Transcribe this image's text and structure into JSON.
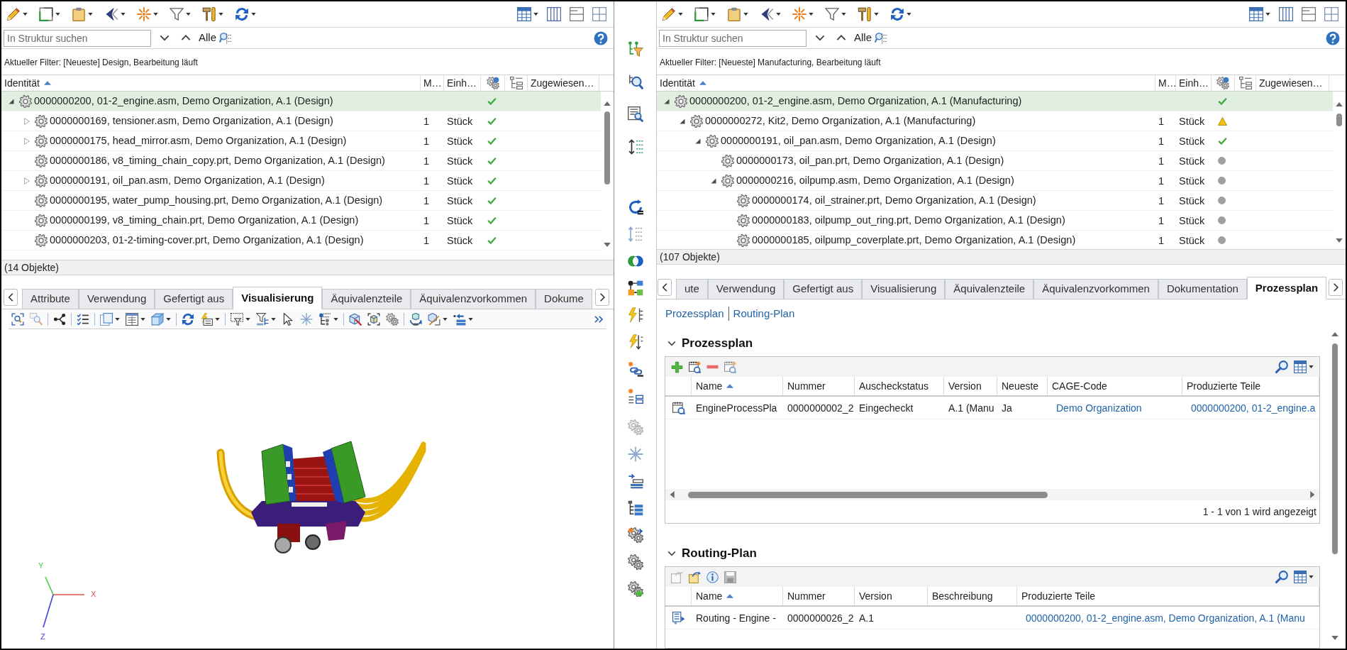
{
  "left_structure": {
    "search": {
      "placeholder": "In Struktur suchen",
      "scope": "Alle"
    },
    "filter": "Aktueller Filter: [Neueste] Design, Bearbeitung läuft",
    "columns": [
      {
        "kind": "text",
        "label": "Identität",
        "sorted": true
      },
      {
        "kind": "text",
        "label": "M…"
      },
      {
        "kind": "text",
        "label": "Einh…"
      },
      {
        "kind": "icon"
      },
      {
        "kind": "icon"
      },
      {
        "kind": "text",
        "label": "Zugewiesen…"
      }
    ],
    "rows": [
      {
        "identity": "0000000200, 01-2_engine.asm, Demo Organization, A.1 (Design)",
        "status": {
          "kind": "check"
        },
        "selected": true,
        "expanded": true,
        "children": [
          {
            "identity": "0000000169, tensioner.asm, Demo Organization, A.1 (Design)",
            "quantity": "1",
            "unit": "Stück",
            "status": {
              "kind": "check"
            },
            "selected": false,
            "expanded": false
          },
          {
            "identity": "0000000175, head_mirror.asm, Demo Organization, A.1 (Design)",
            "quantity": "1",
            "unit": "Stück",
            "status": {
              "kind": "check"
            },
            "selected": false,
            "expanded": false
          },
          {
            "identity": "0000000186, v8_timing_chain_copy.prt, Demo Organization, A.1 (Design)",
            "quantity": "1",
            "unit": "Stück",
            "status": {
              "kind": "check"
            },
            "selected": false
          },
          {
            "identity": "0000000191, oil_pan.asm, Demo Organization, A.1 (Design)",
            "quantity": "1",
            "unit": "Stück",
            "status": {
              "kind": "check"
            },
            "selected": false,
            "expanded": false
          },
          {
            "identity": "0000000195, water_pump_housing.prt, Demo Organization, A.1 (Design)",
            "quantity": "1",
            "unit": "Stück",
            "status": {
              "kind": "check"
            },
            "selected": false
          },
          {
            "identity": "0000000199, v8_timing_chain.prt, Demo Organization, A.1 (Design)",
            "quantity": "1",
            "unit": "Stück",
            "status": {
              "kind": "check"
            },
            "selected": false
          },
          {
            "identity": "0000000203, 01-2-timing-cover.prt, Demo Organization, A.1 (Design)",
            "quantity": "1",
            "unit": "Stück",
            "status": {
              "kind": "check"
            },
            "selected": false
          }
        ]
      }
    ],
    "count": "(14 Objekte)"
  },
  "left_details": {
    "tabs": [
      {
        "label": "Attribute",
        "selected": false
      },
      {
        "label": "Verwendung",
        "selected": false
      },
      {
        "label": "Gefertigt aus",
        "selected": false
      },
      {
        "label": "Visualisierung",
        "selected": true
      },
      {
        "label": "Äquivalenzteile",
        "selected": false
      },
      {
        "label": "Äquivalenzvorkommen",
        "selected": false
      },
      {
        "label": "Dokume",
        "selected": false
      }
    ],
    "viewer": {
      "axis_labels": {
        "y": "Y",
        "x": "X",
        "z": "Z"
      }
    }
  },
  "right_structure": {
    "search": {
      "placeholder": "In Struktur suchen",
      "scope": "Alle"
    },
    "filter": "Aktueller Filter: [Neueste] Manufacturing, Bearbeitung läuft",
    "columns": [
      {
        "kind": "text",
        "label": "Identität",
        "sorted": true
      },
      {
        "kind": "text",
        "label": "M…"
      },
      {
        "kind": "text",
        "label": "Einh…"
      },
      {
        "kind": "icon"
      },
      {
        "kind": "icon"
      },
      {
        "kind": "text",
        "label": "Zugewiesen…"
      }
    ],
    "rows": [
      {
        "identity": "0000000200, 01-2_engine.asm, Demo Organization, A.1 (Manufacturing)",
        "status": {
          "kind": "check"
        },
        "selected": true,
        "expanded": true,
        "children": [
          {
            "identity": "0000000272, Kit2, Demo Organization, A.1 (Manufacturing)",
            "quantity": "1",
            "unit": "Stück",
            "status": {
              "kind": "warning"
            },
            "selected": false,
            "expanded": true,
            "children": [
              {
                "identity": "0000000191, oil_pan.asm, Demo Organization, A.1 (Design)",
                "quantity": "1",
                "unit": "Stück",
                "status": {
                  "kind": "check"
                },
                "selected": false,
                "expanded": true,
                "children": [
                  {
                    "identity": "0000000173, oil_pan.prt, Demo Organization, A.1 (Design)",
                    "quantity": "1",
                    "unit": "Stück",
                    "status": {
                      "kind": "dot"
                    },
                    "selected": false
                  },
                  {
                    "identity": "0000000216, oilpump.asm, Demo Organization, A.1 (Design)",
                    "quantity": "1",
                    "unit": "Stück",
                    "status": {
                      "kind": "dot"
                    },
                    "selected": false,
                    "expanded": true,
                    "children": [
                      {
                        "identity": "0000000174, oil_strainer.prt, Demo Organization, A.1 (Design)",
                        "quantity": "1",
                        "unit": "Stück",
                        "status": {
                          "kind": "dot"
                        },
                        "selected": false
                      },
                      {
                        "identity": "0000000183, oilpump_out_ring.prt, Demo Organization, A.1 (Design)",
                        "quantity": "1",
                        "unit": "Stück",
                        "status": {
                          "kind": "dot"
                        },
                        "selected": false
                      },
                      {
                        "identity": "0000000185, oilpump_coverplate.prt, Demo Organization, A.1 (Design)",
                        "quantity": "1",
                        "unit": "Stück",
                        "status": {
                          "kind": "dot"
                        },
                        "selected": false
                      }
                    ]
                  }
                ]
              }
            ]
          }
        ]
      }
    ],
    "count": "(107 Objekte)"
  },
  "right_details": {
    "tabs": [
      {
        "label": "ute",
        "selected": false
      },
      {
        "label": "Verwendung",
        "selected": false
      },
      {
        "label": "Gefertigt aus",
        "selected": false
      },
      {
        "label": "Visualisierung",
        "selected": false
      },
      {
        "label": "Äquivalenzteile",
        "selected": false
      },
      {
        "label": "Äquivalenzvorkommen",
        "selected": false
      },
      {
        "label": "Dokumentation",
        "selected": false
      },
      {
        "label": "Prozessplan",
        "selected": true
      }
    ],
    "links": [
      "Prozessplan",
      "Routing-Plan"
    ],
    "sections": [
      {
        "kind": "process",
        "title": "Prozessplan",
        "expanded": true,
        "columns": [
          {
            "label": "Name",
            "sorted": true
          },
          {
            "label": "Nummer"
          },
          {
            "label": "Auscheckstatus"
          },
          {
            "label": "Version"
          },
          {
            "label": "Neueste"
          },
          {
            "label": "CAGE-Code"
          },
          {
            "label": "Produzierte Teile"
          }
        ],
        "rows": [
          {
            "name": "EngineProcessPla",
            "number": "0000000002_2",
            "checkout_status": "Eingecheckt",
            "version": "A.1 (Manu",
            "latest": "Ja",
            "cage_code": "Demo Organization",
            "produced_parts": "0000000200, 01-2_engine.a"
          }
        ],
        "pager": "1 - 1 von 1 wird angezeigt"
      },
      {
        "kind": "routing",
        "title": "Routing-Plan",
        "expanded": true,
        "columns": [
          {
            "label": "Name",
            "sorted": true
          },
          {
            "label": "Nummer"
          },
          {
            "label": "Version"
          },
          {
            "label": "Beschreibung"
          },
          {
            "label": "Produzierte Teile"
          }
        ],
        "rows": [
          {
            "name": "Routing - Engine -",
            "number": "0000000026_2",
            "version": "A.1",
            "produced_parts": "0000000200, 01-2_engine.asm, Demo Organization, A.1 (Manu"
          }
        ]
      }
    ]
  }
}
